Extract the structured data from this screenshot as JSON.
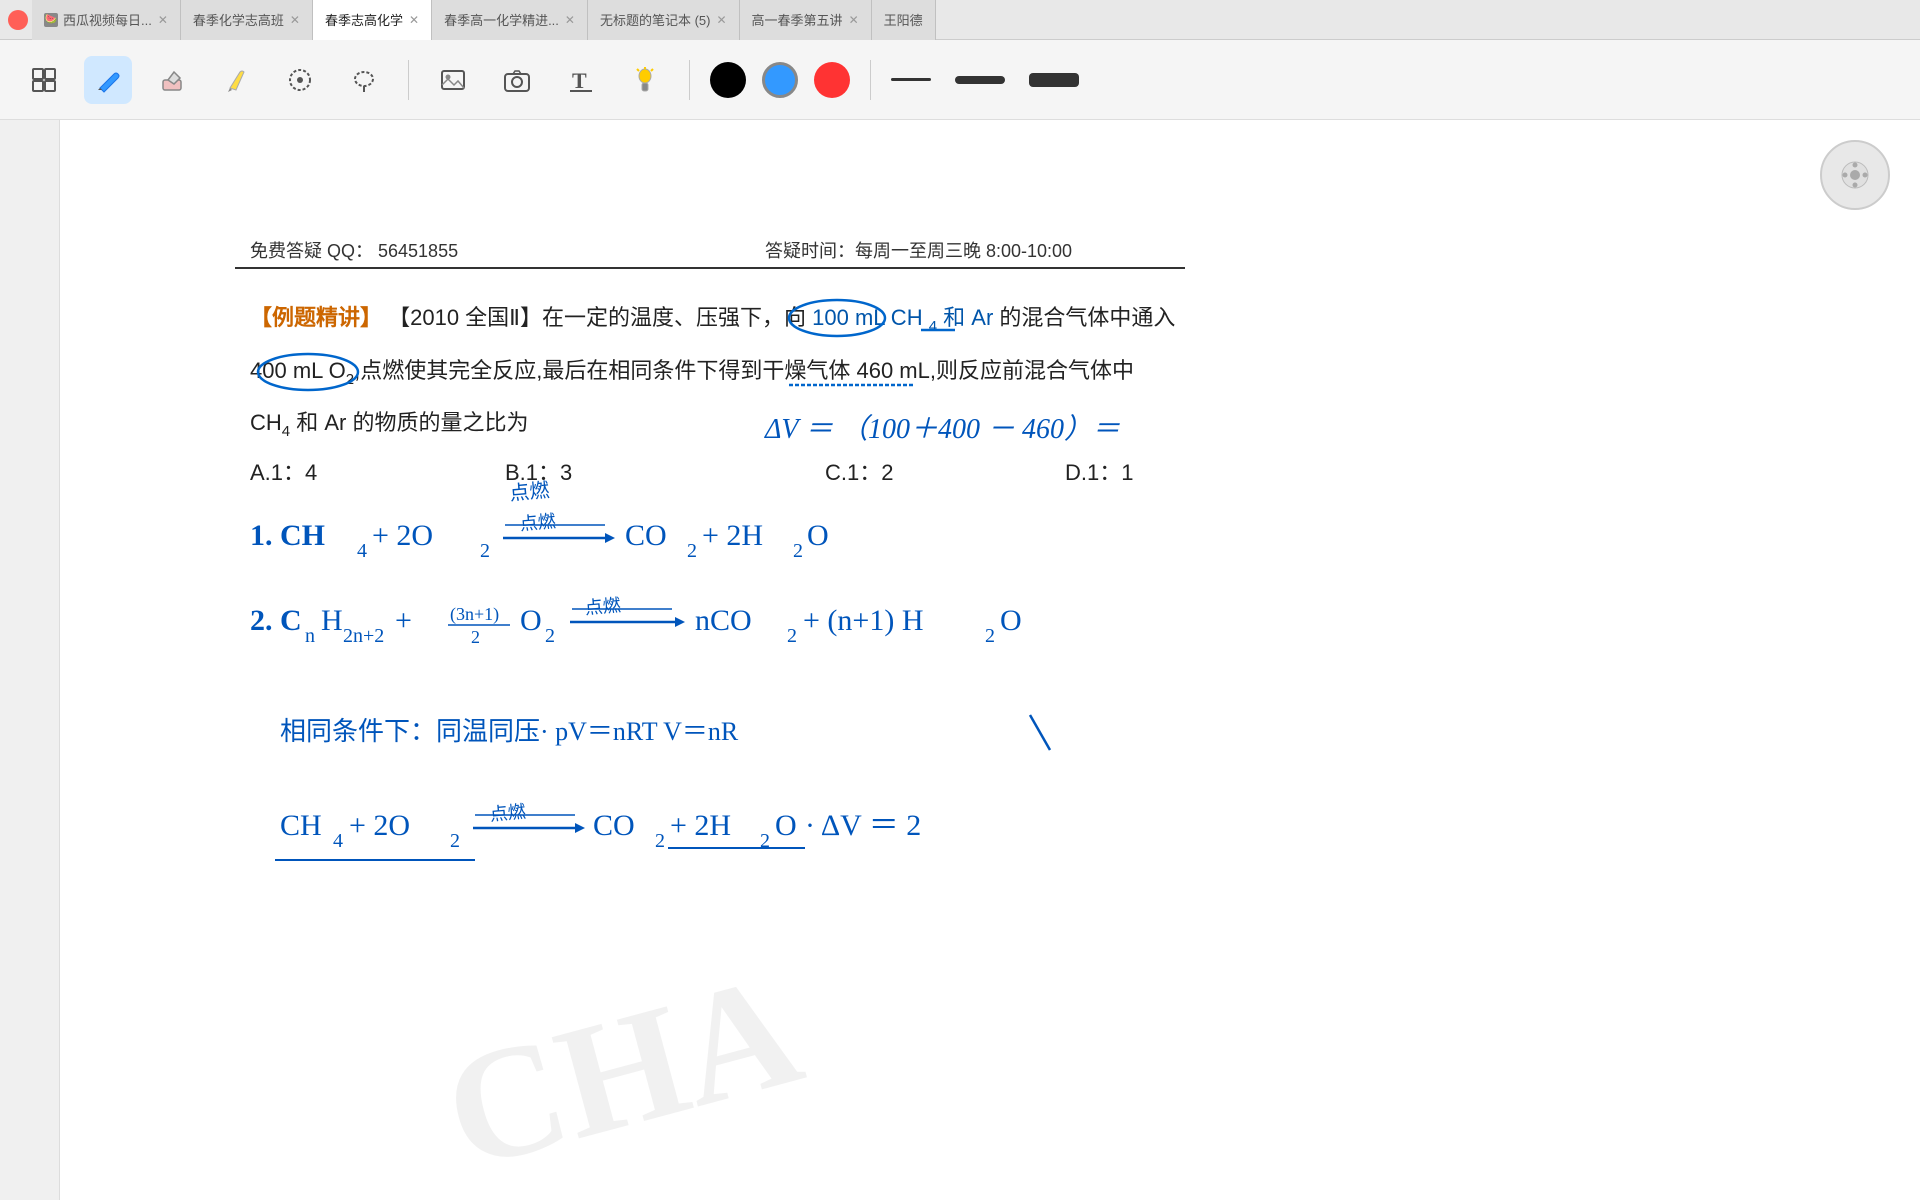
{
  "titlebar": {
    "close_icon": "✕",
    "tabs": [
      {
        "label": "西瓜视频每日...",
        "active": false,
        "favicon": "🍉"
      },
      {
        "label": "春季化学志高班",
        "active": false
      },
      {
        "label": "春季志高化学",
        "active": true
      },
      {
        "label": "春季高一化学精进...",
        "active": false
      },
      {
        "label": "无标题的笔记本 (5)",
        "active": false
      },
      {
        "label": "高一春季第五讲",
        "active": false
      },
      {
        "label": "王阳德",
        "active": false
      }
    ]
  },
  "toolbar": {
    "tools": [
      {
        "id": "layout",
        "icon": "⊡",
        "active": false,
        "label": "布局"
      },
      {
        "id": "pen",
        "icon": "✏",
        "active": true,
        "label": "画笔"
      },
      {
        "id": "eraser",
        "icon": "◻",
        "active": false,
        "label": "橡皮"
      },
      {
        "id": "marker",
        "icon": "〆",
        "active": false,
        "label": "标记"
      },
      {
        "id": "select",
        "icon": "⬡",
        "active": false,
        "label": "选择"
      },
      {
        "id": "lasso",
        "icon": "◯",
        "active": false,
        "label": "套索"
      },
      {
        "id": "image",
        "icon": "🖼",
        "active": false,
        "label": "图片"
      },
      {
        "id": "camera",
        "icon": "📷",
        "active": false,
        "label": "相机"
      },
      {
        "id": "text",
        "icon": "T",
        "active": false,
        "label": "文字"
      },
      {
        "id": "shape",
        "icon": "🔦",
        "active": false,
        "label": "形状"
      }
    ],
    "colors": [
      {
        "hex": "#000000",
        "selected": false
      },
      {
        "hex": "#3399ff",
        "selected": true
      },
      {
        "hex": "#ff3333",
        "selected": false
      }
    ],
    "strokes": [
      {
        "width": 3,
        "label": "细"
      },
      {
        "width": 8,
        "label": "中"
      },
      {
        "width": 14,
        "label": "粗"
      }
    ]
  },
  "content": {
    "info_left": "免费答疑 QQ：  56451855",
    "info_right": "答疑时间：每周一至周三晚 8:00-10:00",
    "question_intro": "【例题精讲】【2010 全国Ⅱ】在一定的温度、压强下，向 100 mL CH₄ 和 Ar 的混合气体中通入",
    "question_body": "400 mL O₂,点燃使其完全反应,最后在相同条件下得到干燥气体 460 mL,则反应前混合气体中",
    "question_end": "CH₄ 和 Ar 的物质的量之比为",
    "choices": [
      "A.1：4",
      "B.1：3",
      "C.1：2",
      "D.1：1"
    ],
    "delta_v": "ΔV＝（100＋400－460）＝",
    "formula1": "1. CH₄ ＋2O₂ →点燃→ CO₂ ＋ 2H₂O",
    "formula2": "2. CₙH₂ₙ₊₂ ＋ (3n+1/2)O₂ →点燃→ nCO₂ ＋ (n+1)H₂O",
    "condition": "相同条件下：同温同压·    pV＝nRT    V＝nR",
    "formula3": "CH₄ ＋ 2O₂ →点燃→ CO₂ ＋ 2H₂O·  ΔV＝2",
    "watermark": "CHA"
  }
}
